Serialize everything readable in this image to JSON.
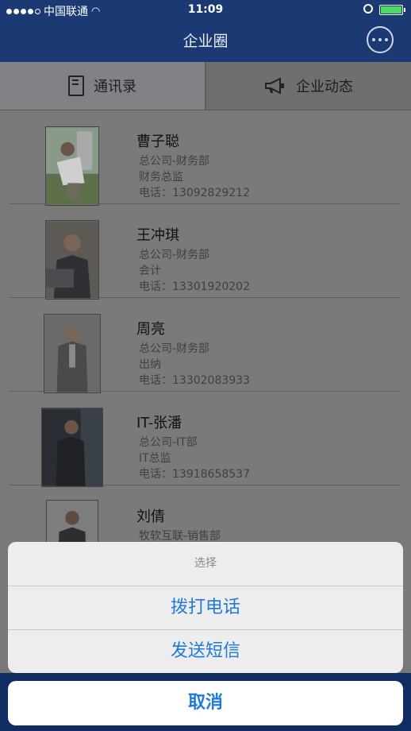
{
  "status": {
    "carrier": "中国联通",
    "time": "11:09"
  },
  "nav": {
    "title": "企业圈"
  },
  "tabs": [
    {
      "label": "通讯录",
      "icon": "book-icon"
    },
    {
      "label": "企业动态",
      "icon": "megaphone-icon"
    }
  ],
  "contacts": [
    {
      "name": "曹子聪",
      "dept": "总公司-财务部",
      "title": "财务总监",
      "phone": "电话：13092829212"
    },
    {
      "name": "王冲琪",
      "dept": "总公司-财务部",
      "title": "会计",
      "phone": "电话：13301920202"
    },
    {
      "name": "周亮",
      "dept": "总公司-财务部",
      "title": "出纳",
      "phone": "电话：13302083933"
    },
    {
      "name": "IT-张潘",
      "dept": "总公司-IT部",
      "title": "IT总监",
      "phone": "电话：13918658537"
    },
    {
      "name": "刘倩",
      "dept": "牧软互联-销售部",
      "title": "",
      "phone": ""
    }
  ],
  "sheet": {
    "title": "选择",
    "call": "拨打电话",
    "sms": "发送短信",
    "cancel": "取消"
  },
  "colors": {
    "nav": "#1b3a73",
    "accent": "#1f7ad9"
  }
}
